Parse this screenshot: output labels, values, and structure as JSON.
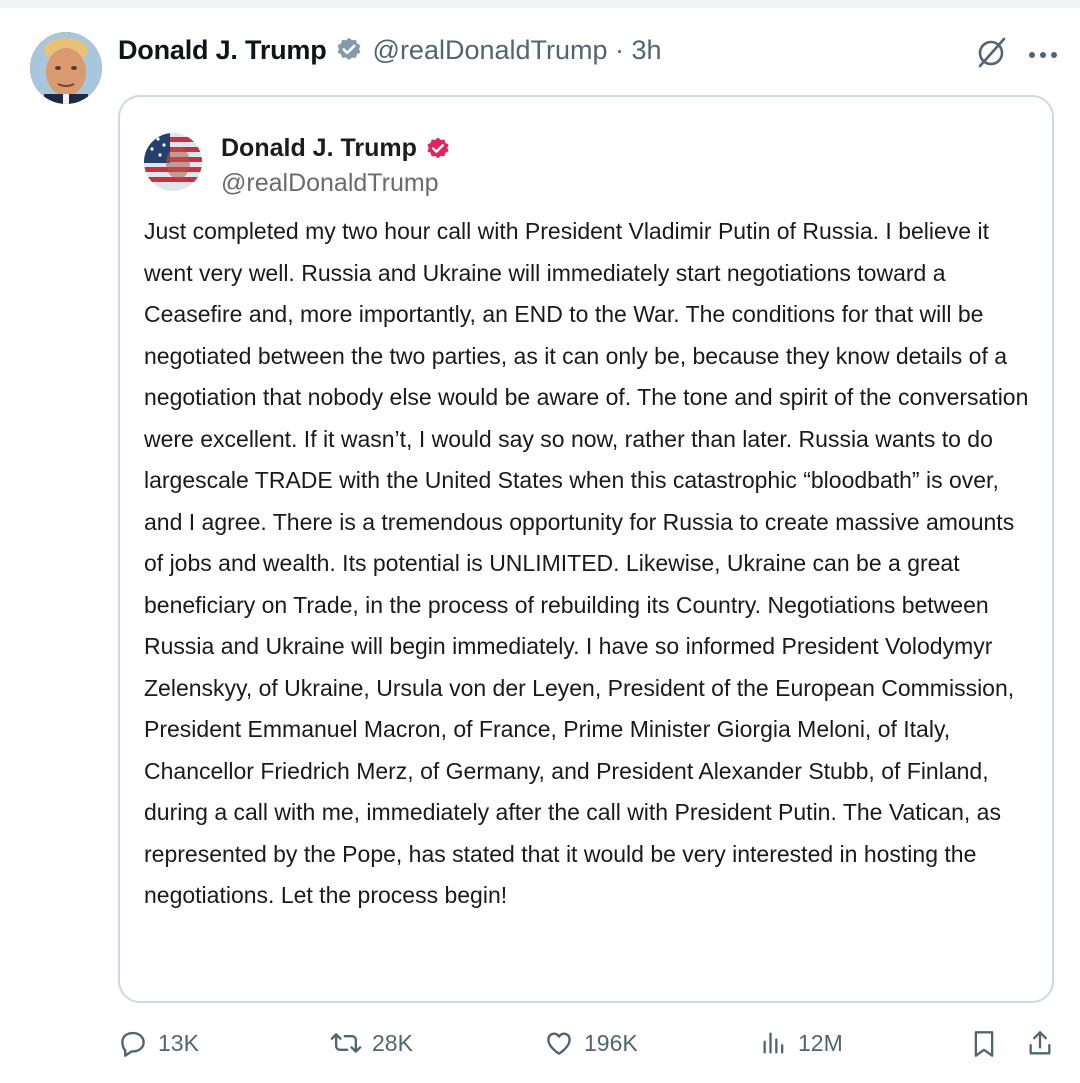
{
  "post": {
    "author": {
      "display_name": "Donald J. Trump",
      "handle_meta": "@realDonaldTrump · 3h"
    },
    "header_icons": [
      "grok-slash-icon",
      "more-icon"
    ],
    "quoted": {
      "display_name": "Donald J. Trump",
      "handle": "@realDonaldTrump",
      "body": "Just completed my two hour call with President Vladimir Putin of Russia. I believe it went very well. Russia and Ukraine will immediately start negotiations toward a Ceasefire and, more importantly, an END to the War. The conditions for that will be negotiated between the two parties, as it can only be, because they know details of a negotiation that nobody else would be aware of. The tone and spirit of the conversation were excellent. If it wasn’t, I would say so now, rather than later. Russia wants to do largescale TRADE with the United States when this catastrophic “bloodbath” is over, and I agree. There is a tremendous opportunity for Russia to create massive amounts of jobs and wealth. Its potential is UNLIMITED. Likewise, Ukraine can be a great beneficiary on Trade, in the process of rebuilding its Country. Negotiations between Russia and Ukraine will begin immediately. I have so informed President Volodymyr Zelenskyy, of Ukraine, Ursula von der Leyen, President of the European Commission, President Emmanuel Macron, of France, Prime Minister Giorgia Meloni, of Italy, Chancellor Friedrich Merz, of Germany, and President Alexander Stubb, of Finland, during a call with me, immediately after the call with President Putin. The Vatican, as represented by the Pope, has stated that it would be very interested in hosting the negotiations. Let the process begin!"
    },
    "actions": {
      "replies": "13K",
      "reposts": "28K",
      "likes": "196K",
      "views": "12M"
    }
  },
  "colors": {
    "text_primary": "#0f1419",
    "text_secondary": "#536471",
    "border": "#cfd9de",
    "verified_gray": "#829aab",
    "truth_badge": "#e0245e"
  }
}
